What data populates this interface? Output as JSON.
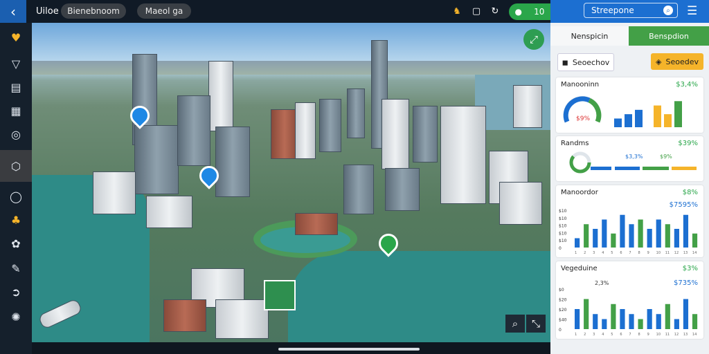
{
  "topbar": {
    "back_icon": "chevron-left-icon",
    "app_title": "Uiloe",
    "pill1": "Bienebnoom",
    "pill2": "Maeol ga",
    "green_pill_value": "10"
  },
  "panel": {
    "search_label": "Streepone",
    "tab1": "Nenspicin",
    "tab2": "Benspdion",
    "button1": "Seoechov",
    "button2": "Seoedev",
    "cards": [
      {
        "title": "Manooninn",
        "value": "$3,4%",
        "gauge_label": "$9%"
      },
      {
        "title": "Randms",
        "value": "$39%",
        "sub1": "$3,3%",
        "sub2": "$9%"
      },
      {
        "title": "Manoordor",
        "value": "$8%",
        "value2": "$7595%"
      },
      {
        "title": "Vegeduine",
        "value": "$3%",
        "value2": "$735%",
        "annotation": "2,3%"
      }
    ]
  },
  "chart_data": [
    {
      "type": "bar",
      "series": [
        {
          "name": "",
          "values": [
            2,
            3,
            4
          ]
        },
        {
          "name": "",
          "values": [
            5,
            3,
            6
          ]
        }
      ]
    },
    {
      "type": "bar",
      "categories": [
        "1",
        "2",
        "3",
        "4",
        "5",
        "6",
        "7",
        "8",
        "9",
        "10",
        "11",
        "12",
        "13",
        "14"
      ],
      "values": [
        2,
        5,
        4,
        6,
        3,
        7,
        5,
        6,
        4,
        6,
        5,
        4,
        7,
        3
      ],
      "yticks": [
        "$10",
        "$10",
        "$10",
        "$10",
        "$10",
        "0"
      ]
    },
    {
      "type": "bar",
      "categories": [
        "1",
        "2",
        "3",
        "4",
        "5",
        "6",
        "7",
        "8",
        "9",
        "10",
        "11",
        "12",
        "13",
        "14"
      ],
      "values": [
        4,
        6,
        3,
        2,
        5,
        4,
        3,
        2,
        4,
        3,
        5,
        2,
        6,
        3
      ],
      "yticks": [
        "$0",
        "$20",
        "$20",
        "$40",
        "0"
      ]
    }
  ],
  "colors": {
    "accent": "#1c6fd1",
    "green": "#43a047",
    "yellow": "#f5b42a"
  }
}
